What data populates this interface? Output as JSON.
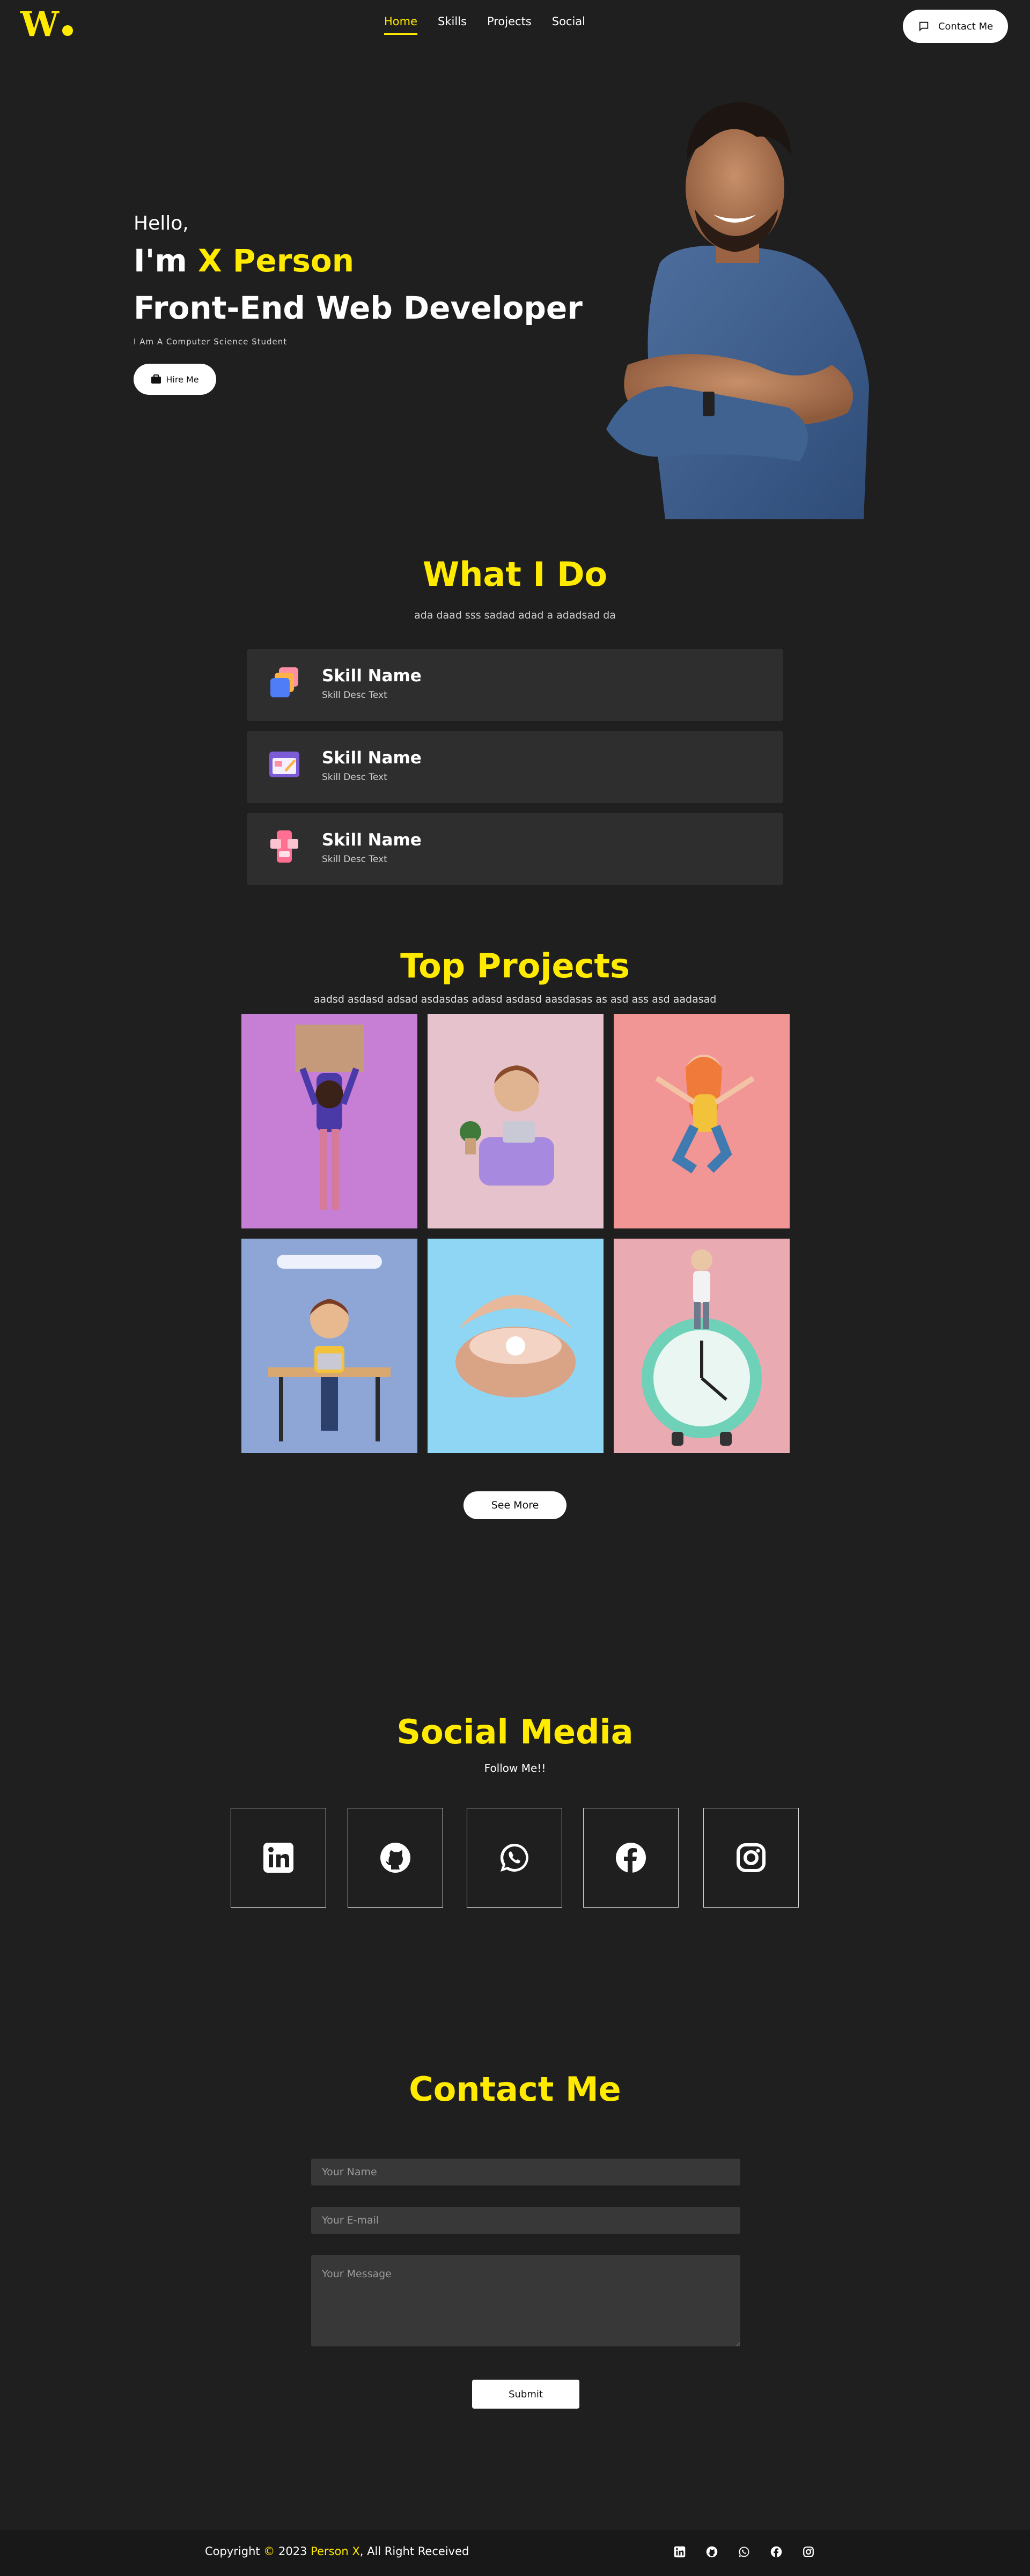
{
  "nav": {
    "logo": "W",
    "links": [
      "Home",
      "Skills",
      "Projects",
      "Social"
    ],
    "contact_label": "Contact Me"
  },
  "hero": {
    "hello": "Hello,",
    "im_prefix": "I'm ",
    "name": "X Person",
    "role": "Front-End Web Developer",
    "subtitle": "I Am A Computer Science Student",
    "hire_label": "Hire Me"
  },
  "what_i_do": {
    "title": "What I Do",
    "subtitle": "ada daad sss sadad adad a adadsad da",
    "skills": [
      {
        "name": "Skill Name",
        "desc": "Skill Desc Text",
        "icon": "stacked-layers-icon"
      },
      {
        "name": "Skill Name",
        "desc": "Skill Desc Text",
        "icon": "design-palette-icon"
      },
      {
        "name": "Skill Name",
        "desc": "Skill Desc Text",
        "icon": "mobile-app-icon"
      }
    ]
  },
  "projects": {
    "title": "Top Projects",
    "subtitle": "aadsd asdasd adsad asdasdas adasd asdasd aasdasas as asd ass asd aadasad",
    "see_more": "See More"
  },
  "social": {
    "title": "Social Media",
    "subtitle": "Follow Me!!",
    "icons": [
      "linkedin-icon",
      "github-icon",
      "whatsapp-icon",
      "facebook-icon",
      "instagram-icon"
    ]
  },
  "contact": {
    "title": "Contact Me",
    "name_placeholder": "Your Name",
    "email_placeholder": "Your E-mail",
    "message_placeholder": "Your Message",
    "submit_label": "Submit"
  },
  "footer": {
    "copyright_prefix": "Copyright ",
    "copyright_symbol": "©",
    "year": " 2023 ",
    "name": "Person X",
    "suffix": ", All Right Received"
  },
  "colors": {
    "accent": "#ffea00",
    "background": "#1f1f1f",
    "card": "#2e2e2e",
    "footer": "#181818"
  }
}
